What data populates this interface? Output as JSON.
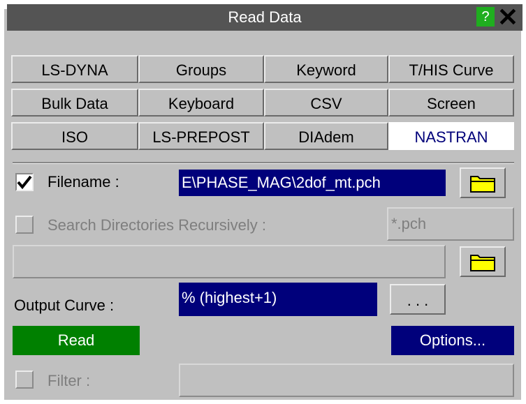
{
  "window": {
    "title": "Read Data",
    "help_label": "?",
    "close_label": "✕"
  },
  "tabs": [
    "LS-DYNA",
    "Groups",
    "Keyword",
    "T/HIS Curve",
    "Bulk Data",
    "Keyboard",
    "CSV",
    "Screen",
    "ISO",
    "LS-PREPOST",
    "DIAdem",
    "NASTRAN"
  ],
  "active_tab": "NASTRAN",
  "filename": {
    "label": "Filename :",
    "checked": true,
    "value": "E\\PHASE_MAG\\2dof_mt.pch"
  },
  "search": {
    "label": "Search Directories Recursively :",
    "checked": false,
    "pattern": "*.pch"
  },
  "directory": {
    "value": ""
  },
  "output_curve": {
    "label": "Output Curve :",
    "value": "% (highest+1)",
    "more_label": ". . ."
  },
  "actions": {
    "read_label": "Read",
    "options_label": "Options..."
  },
  "filter": {
    "label": "Filter :",
    "checked": false,
    "value": ""
  },
  "colors": {
    "accent": "#00007b",
    "read_button": "#008000",
    "folder": "#ffff00",
    "title_bar": "#545454"
  }
}
